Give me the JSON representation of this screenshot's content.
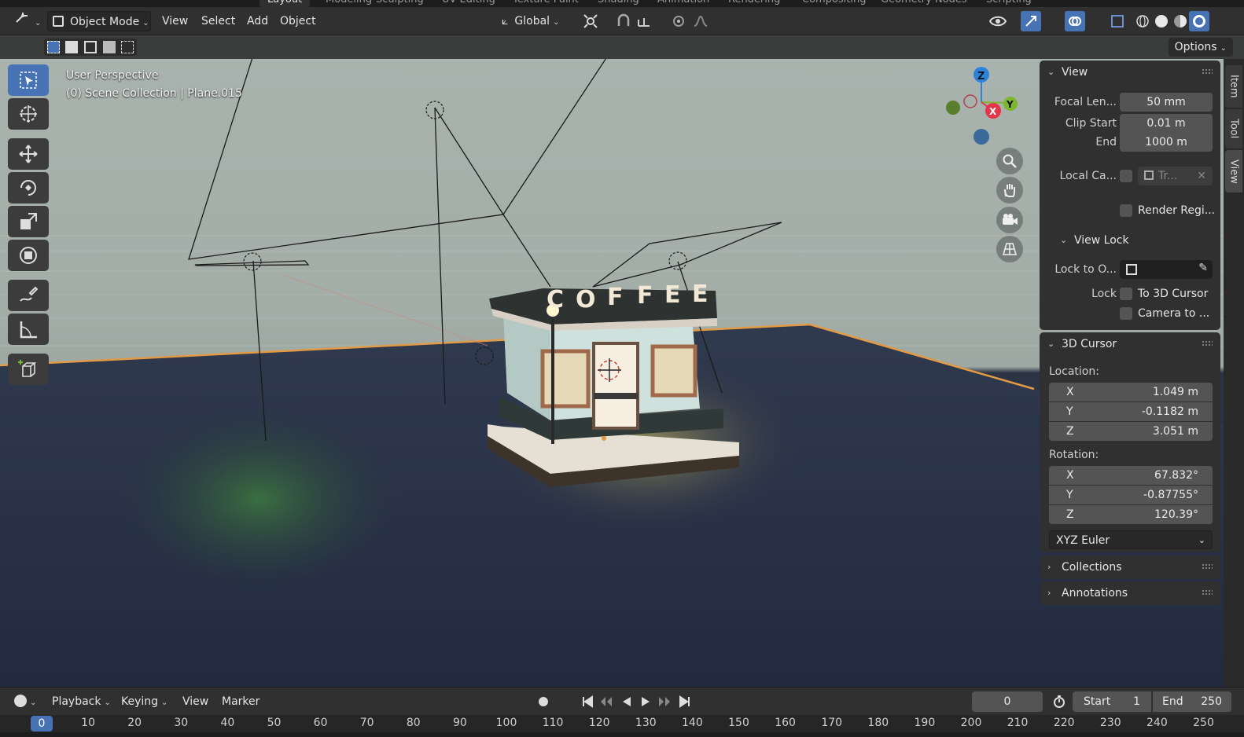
{
  "workspace_tabs": [
    "Layout",
    "Modeling",
    "Sculpting",
    "UV Editing",
    "Texture Paint",
    "Shading",
    "Animation",
    "Rendering",
    "Compositing",
    "Geometry Nodes",
    "Scripting"
  ],
  "header": {
    "mode": "Object Mode",
    "menus": [
      "View",
      "Select",
      "Add",
      "Object"
    ],
    "transform_orientation": "Global",
    "options_label": "Options"
  },
  "viewport": {
    "view_name": "User Perspective",
    "collection_info": "(0) Scene Collection | Plane.015",
    "sign_text": [
      "C",
      "O",
      "F",
      "F",
      "E",
      "E"
    ],
    "gizmo_axes": {
      "z": "Z",
      "y": "Y",
      "x": "X"
    }
  },
  "toolbar": [
    "select-box",
    "cursor",
    "move",
    "rotate",
    "scale",
    "transform",
    "annotate",
    "measure",
    "add-cube"
  ],
  "npanel": {
    "view": {
      "title": "View",
      "focal_length_label": "Focal Len...",
      "focal_length": "50 mm",
      "clip_start_label": "Clip Start",
      "clip_start": "0.01 m",
      "clip_end_label": "End",
      "clip_end": "1000 m",
      "local_camera_label": "Local Ca...",
      "local_camera_value": "Tr...",
      "render_region_label": "Render Regi...",
      "view_lock_title": "View Lock",
      "lock_to_object_label": "Lock to O...",
      "lock_label": "Lock",
      "lock_3d_cursor_label": "To 3D Cursor",
      "lock_camera_label": "Camera to ..."
    },
    "cursor": {
      "title": "3D Cursor",
      "location_label": "Location:",
      "location": [
        {
          "axis": "X",
          "value": "1.049 m"
        },
        {
          "axis": "Y",
          "value": "-0.1182 m"
        },
        {
          "axis": "Z",
          "value": "3.051 m"
        }
      ],
      "rotation_label": "Rotation:",
      "rotation": [
        {
          "axis": "X",
          "value": "67.832°"
        },
        {
          "axis": "Y",
          "value": "-0.87755°"
        },
        {
          "axis": "Z",
          "value": "120.39°"
        }
      ],
      "rotation_mode": "XYZ Euler"
    },
    "collections_title": "Collections",
    "annotations_title": "Annotations"
  },
  "side_tabs": [
    "Item",
    "Tool",
    "View"
  ],
  "timeline": {
    "menus": [
      "Playback",
      "Keying",
      "View",
      "Marker"
    ],
    "current_frame": "0",
    "start_label": "Start",
    "start": "1",
    "end_label": "End",
    "end": "250",
    "ruler": [
      "0",
      "10",
      "20",
      "30",
      "40",
      "50",
      "60",
      "70",
      "80",
      "90",
      "100",
      "110",
      "120",
      "130",
      "140",
      "150",
      "160",
      "170",
      "180",
      "190",
      "200",
      "210",
      "220",
      "230",
      "240",
      "250"
    ]
  },
  "colors": {
    "accent": "#4772b3",
    "panel": "#303030",
    "field": "#545454",
    "axis_x": "#e5354a",
    "axis_y": "#7cb72d",
    "axis_z": "#2f83d6"
  }
}
